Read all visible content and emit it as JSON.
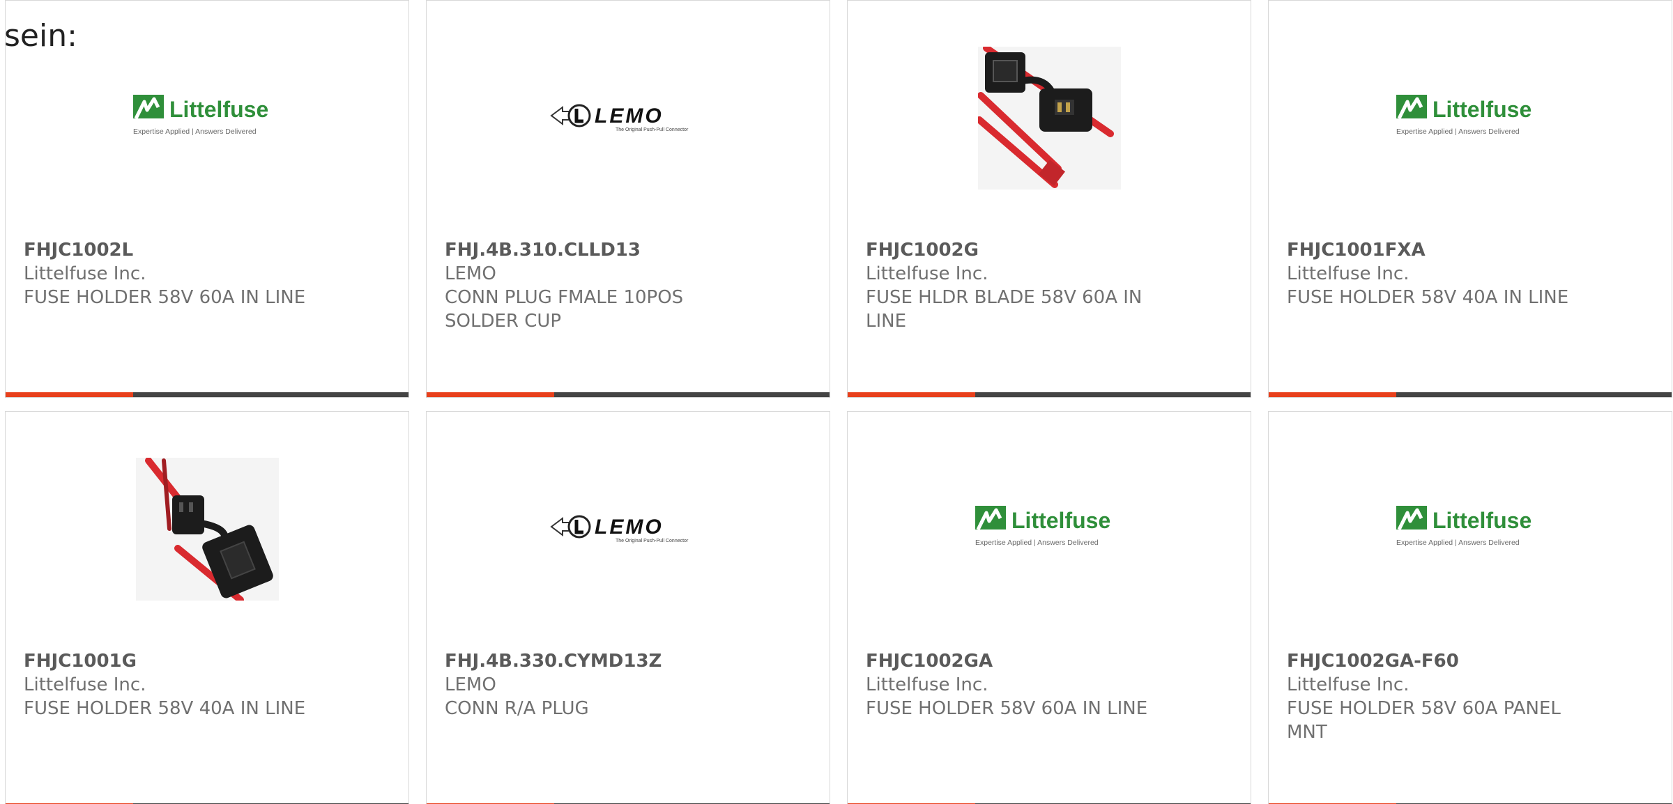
{
  "top_text": "sein:",
  "colors": {
    "accent": "#e8401c",
    "bar": "#444444",
    "littelfuse_green": "#2f8f3a",
    "wire_red": "#d92a2f",
    "holder_black": "#1c1c1c"
  },
  "products": [
    {
      "part_number": "FHJC1002L",
      "manufacturer": "Littelfuse Inc.",
      "description": "FUSE HOLDER 58V 60A IN LINE",
      "image": "littelfuse-logo"
    },
    {
      "part_number": "FHJ.4B.310.CLLD13",
      "manufacturer": "LEMO",
      "description": "CONN PLUG FMALE 10POS SOLDER CUP",
      "image": "lemo-logo"
    },
    {
      "part_number": "FHJC1002G",
      "manufacturer": "Littelfuse Inc.",
      "description": "FUSE HLDR BLADE 58V 60A IN LINE",
      "image": "fuse-holder-photo"
    },
    {
      "part_number": "FHJC1001FXA",
      "manufacturer": "Littelfuse Inc.",
      "description": "FUSE HOLDER 58V 40A IN LINE",
      "image": "littelfuse-logo"
    },
    {
      "part_number": "FHJC1001G",
      "manufacturer": "Littelfuse Inc.",
      "description": "FUSE HOLDER 58V 40A IN LINE",
      "image": "fuse-holder-photo"
    },
    {
      "part_number": "FHJ.4B.330.CYMD13Z",
      "manufacturer": "LEMO",
      "description": "CONN R/A PLUG",
      "image": "lemo-logo"
    },
    {
      "part_number": "FHJC1002GA",
      "manufacturer": "Littelfuse Inc.",
      "description": "FUSE HOLDER 58V 60A IN LINE",
      "image": "littelfuse-logo"
    },
    {
      "part_number": "FHJC1002GA-F60",
      "manufacturer": "Littelfuse Inc.",
      "description": "FUSE HOLDER 58V 60A PANEL MNT",
      "image": "littelfuse-logo"
    }
  ],
  "logos": {
    "littelfuse_name": "Littelfuse",
    "littelfuse_tagline_1": "Expertise Applied",
    "littelfuse_tagline_2": "Answers Delivered",
    "lemo_name": "LEMO",
    "lemo_tagline": "The Original Push-Pull Connector"
  }
}
